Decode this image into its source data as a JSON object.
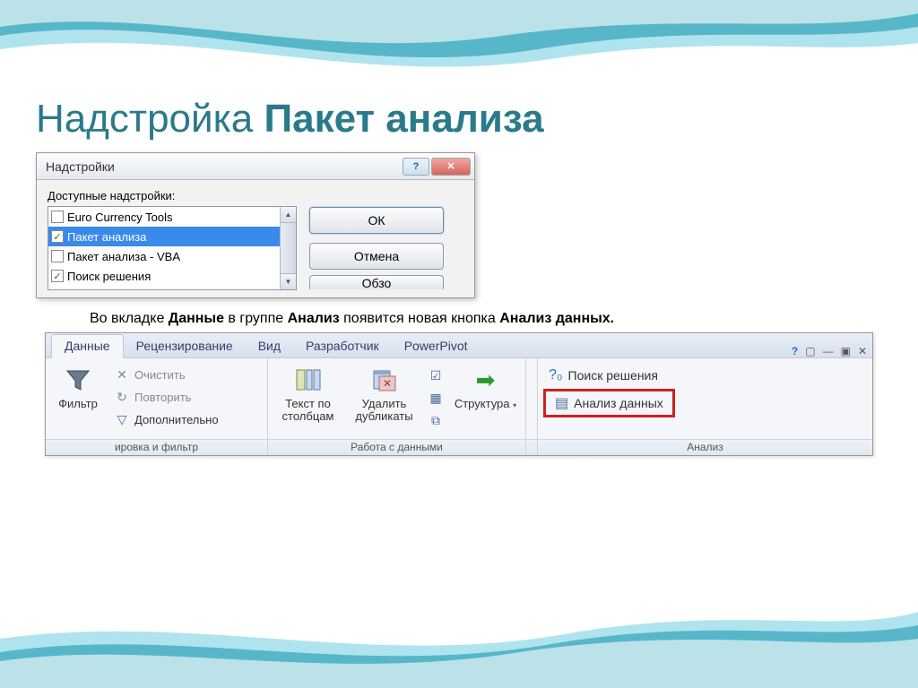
{
  "slide": {
    "title_prefix": "Надстройка ",
    "title_bold": "Пакет анализа"
  },
  "dialog": {
    "title": "Надстройки",
    "available_label": "Доступные надстройки:",
    "items": [
      {
        "label": "Euro Currency Tools",
        "checked": false,
        "selected": false
      },
      {
        "label": "Пакет анализа",
        "checked": true,
        "selected": true
      },
      {
        "label": "Пакет анализа - VBA",
        "checked": false,
        "selected": false
      },
      {
        "label": "Поиск решения",
        "checked": true,
        "selected": false
      }
    ],
    "ok": "ОК",
    "cancel": "Отмена",
    "browse": "Обзор"
  },
  "description": {
    "p1": "Во вкладке ",
    "b1": "Данные",
    "p2": " в группе ",
    "b2": "Анализ",
    "p3": " появится новая кнопка ",
    "b3": "Анализ данных."
  },
  "ribbon": {
    "tabs": [
      "Данные",
      "Рецензирование",
      "Вид",
      "Разработчик",
      "PowerPivot"
    ],
    "filter": {
      "label": "Фильтр",
      "clear": "Очистить",
      "reapply": "Повторить",
      "advanced": "Дополнительно"
    },
    "text_to_columns": "Текст по столбцам",
    "remove_duplicates": "Удалить дубликаты",
    "structure": "Структура",
    "solver": "Поиск решения",
    "data_analysis": "Анализ данных",
    "group_labels": {
      "sort_filter": "ировка и фильтр",
      "data_tools": "Работа с данными",
      "analysis": "Анализ"
    }
  }
}
